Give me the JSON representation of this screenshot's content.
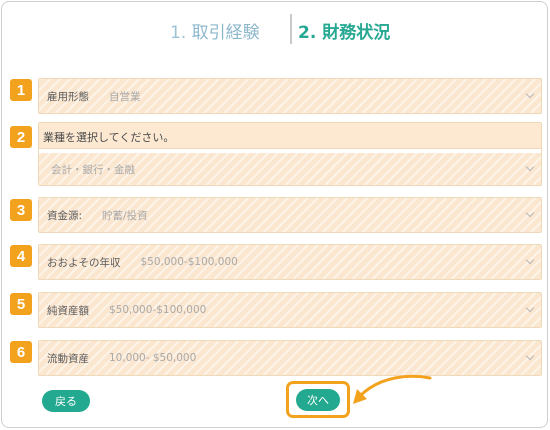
{
  "steps": {
    "step1_num": "1.",
    "step1_label": "取引経験",
    "step2_num": "2.",
    "step2_label": "財務状況"
  },
  "rows": [
    {
      "num": "1",
      "label": "雇用形態",
      "value": "自営業"
    },
    {
      "num": "2",
      "label": "業種を選択してください。",
      "value": "会計・銀行・金融"
    },
    {
      "num": "3",
      "label": "資金源:",
      "value": "貯蓄/投資"
    },
    {
      "num": "4",
      "label": "おおよその年収",
      "value": "$50,000-$100,000"
    },
    {
      "num": "5",
      "label": "純資産額",
      "value": "$50,000-$100,000"
    },
    {
      "num": "6",
      "label": "流動資産",
      "value": "10,000- $50,000"
    }
  ],
  "buttons": {
    "back": "戻る",
    "next": "次へ"
  },
  "colors": {
    "accent": "#22a98f",
    "step_active": "#26a892",
    "step_inactive": "#8db8cc",
    "badge": "#f3a21d",
    "field_bg": "#fbe6cf"
  }
}
